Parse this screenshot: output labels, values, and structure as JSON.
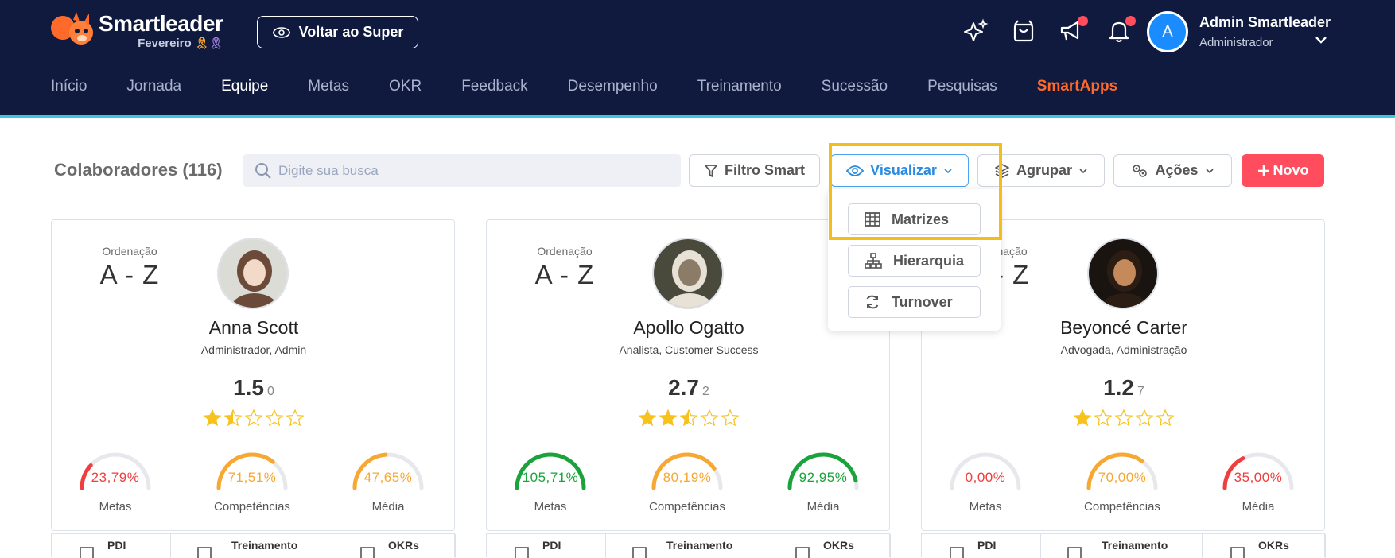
{
  "brand": {
    "name": "Smartleader",
    "month": "Fevereiro"
  },
  "header": {
    "back_button": "Voltar ao Super"
  },
  "user": {
    "initial": "A",
    "name": "Admin Smartleader",
    "role": "Administrador"
  },
  "nav": [
    "Início",
    "Jornada",
    "Equipe",
    "Metas",
    "OKR",
    "Feedback",
    "Desempenho",
    "Treinamento",
    "Sucessão",
    "Pesquisas",
    "SmartApps"
  ],
  "toolbar": {
    "title": "Colaboradores (116)",
    "search_placeholder": "Digite sua busca",
    "filter": "Filtro Smart",
    "visualize": "Visualizar",
    "group": "Agrupar",
    "actions": "Ações",
    "new": "Novo"
  },
  "visualize_menu": [
    "Matrizes",
    "Hierarquia",
    "Turnover"
  ],
  "cards": [
    {
      "order_label": "Ordenação",
      "order_value": "A - Z",
      "name": "Anna Scott",
      "role": "Administrador, Admin",
      "score": "1.5",
      "count": "0",
      "stars": 1.5,
      "gauges": [
        {
          "value": "23,79%",
          "label": "Metas",
          "pct": 23.79,
          "color": "#f03e3e"
        },
        {
          "value": "71,51%",
          "label": "Competências",
          "pct": 71.51,
          "color": "#f7a833"
        },
        {
          "value": "47,65%",
          "label": "Média",
          "pct": 47.65,
          "color": "#f7a833"
        }
      ],
      "footer": [
        "PDI",
        "Treinamento",
        "OKRs"
      ]
    },
    {
      "order_label": "Ordenação",
      "order_value": "A - Z",
      "name": "Apollo Ogatto",
      "role": "Analista, Customer Success",
      "score": "2.7",
      "count": "2",
      "stars": 2.5,
      "gauges": [
        {
          "value": "105,71%",
          "label": "Metas",
          "pct": 100,
          "color": "#1aa33b"
        },
        {
          "value": "80,19%",
          "label": "Competências",
          "pct": 80.19,
          "color": "#f7a833"
        },
        {
          "value": "92,95%",
          "label": "Média",
          "pct": 92.95,
          "color": "#1aa33b"
        }
      ],
      "footer": [
        "PDI",
        "Treinamento",
        "OKRs"
      ]
    },
    {
      "order_label": "Ordenação",
      "order_value": "A - Z",
      "name": "Beyoncé Carter",
      "role": "Advogada, Administração",
      "score": "1.2",
      "count": "7",
      "stars": 1,
      "gauges": [
        {
          "value": "0,00%",
          "label": "Metas",
          "pct": 0,
          "color": "#f03e3e"
        },
        {
          "value": "70,00%",
          "label": "Competências",
          "pct": 70,
          "color": "#f7a833"
        },
        {
          "value": "35,00%",
          "label": "Média",
          "pct": 35,
          "color": "#f03e3e"
        }
      ],
      "footer": [
        "PDI",
        "Treinamento",
        "OKRs"
      ]
    }
  ]
}
